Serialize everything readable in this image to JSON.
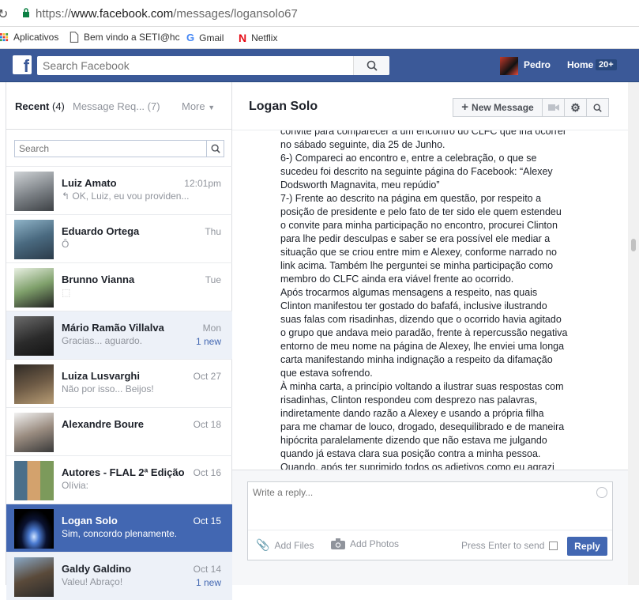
{
  "browser": {
    "url_scheme": "https://",
    "url_host": "www.facebook.com",
    "url_path": "/messages/logansolo67",
    "bookmarks": [
      {
        "label": "Aplicativos"
      },
      {
        "label": "Bem vindo a SETI@hc"
      },
      {
        "label": "Gmail"
      },
      {
        "label": "Netflix"
      }
    ]
  },
  "header": {
    "search_placeholder": "Search Facebook",
    "user_name": "Pedro",
    "home_label": "Home",
    "home_count": "20+",
    "brand_color": "#3b5998"
  },
  "sidebar": {
    "tab_recent": "Recent",
    "tab_recent_count": "(4)",
    "tab_requests": "Message Req... (7)",
    "tab_more": "More",
    "search_placeholder": "Search",
    "threads": [
      {
        "name": "Luiz Amato",
        "preview": "↰ OK, Luiz, eu vou providen...",
        "time": "12:01pm",
        "new": ""
      },
      {
        "name": "Eduardo Ortega",
        "preview": "Ô",
        "time": "Thu",
        "new": ""
      },
      {
        "name": "Brunno Vianna",
        "preview": "⬚",
        "time": "Tue",
        "new": ""
      },
      {
        "name": "Mário Ramão Villalva",
        "preview": "Gracias... aguardo.",
        "time": "Mon",
        "new": "1 new"
      },
      {
        "name": "Luiza Lusvarghi",
        "preview": "Não por isso... Beijos!",
        "time": "Oct 27",
        "new": ""
      },
      {
        "name": "Alexandre Boure",
        "preview": "",
        "time": "Oct 18",
        "new": ""
      },
      {
        "name": "Autores - FLAL 2ª Edição",
        "preview": "Olívia:",
        "time": "Oct 16",
        "new": ""
      },
      {
        "name": "Logan Solo",
        "preview": "Sim, concordo plenamente.",
        "time": "Oct 15",
        "new": ""
      },
      {
        "name": "Galdy Galdino",
        "preview": "Valeu! Abraço!",
        "time": "Oct 14",
        "new": "1 new"
      }
    ]
  },
  "conversation": {
    "title": "Logan Solo",
    "new_message_label": "New Message",
    "lines": [
      "convite para comparecer a um encontro do CLFC que iria ocorrer",
      "no sábado seguinte, dia 25 de Junho.",
      "6-) Compareci ao encontro e, entre a celebração, o que se",
      "sucedeu foi descrito na seguinte página do Facebook: “Alexey",
      "Dodsworth Magnavita, meu repúdio”",
      "7-) Frente ao descrito na página em questão, por respeito a",
      "posição de presidente e pelo fato de ter sido ele quem estendeu",
      "o convite para minha participação no encontro, procurei Clinton",
      "para lhe pedir desculpas e saber se era possível ele mediar a",
      "situação que se criou entre mim e Alexey, conforme narrado no",
      "link acima. Também lhe perguntei se minha participação como",
      "membro do CLFC ainda era viável frente ao ocorrido.",
      "Após trocarmos algumas mensagens a respeito, nas quais",
      "Clinton manifestou ter gostado do bafafá, inclusive ilustrando",
      "suas falas com risadinhas, dizendo que o ocorrido havia agitado",
      "o grupo que andava meio paradão, frente à repercussão negativa",
      "entorno de meu nome na página de Alexey, lhe enviei uma longa",
      "carta manifestando minha indignação a respeito da difamação",
      "que estava sofrendo.",
      "À minha carta, a princípio voltando a ilustrar suas respostas com",
      "risadinhas, Clinton respondeu com desprezo nas palavras,",
      "indiretamente dando razão a Alexey  e usando a própria filha",
      "para me chamar de louco, drogado, desequilibrado e de maneira",
      "hipócrita paralelamente dizendo que não estava me julgando",
      "quando já estava  clara sua posição contra a minha pessoa.",
      "Quando, após ter suprimido todos os adjetivos como eu agrazi"
    ]
  },
  "composer": {
    "placeholder": "Write a reply...",
    "add_files": "Add Files",
    "add_photos": "Add Photos",
    "press_enter": "Press Enter to send",
    "reply_label": "Reply"
  }
}
